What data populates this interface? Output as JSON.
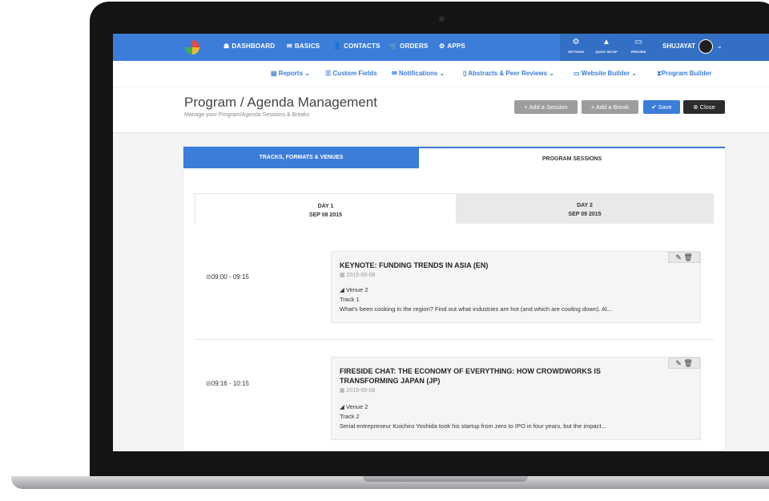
{
  "nav": {
    "items": [
      {
        "icon": "dashboard-icon",
        "glyph": "☗",
        "label": "DASHBOARD"
      },
      {
        "icon": "megaphone-icon",
        "glyph": "✉",
        "label": "BASICS"
      },
      {
        "icon": "user-icon",
        "glyph": "👤",
        "label": "CONTACTS"
      },
      {
        "icon": "cart-icon",
        "glyph": "🛒",
        "label": "ORDERS"
      },
      {
        "icon": "cogs-icon",
        "glyph": "⚙",
        "label": "APPS"
      }
    ],
    "tools": [
      {
        "icon": "settings-icon",
        "glyph": "⚙",
        "label": "SETTINGS"
      },
      {
        "icon": "rocket-icon",
        "glyph": "▲",
        "label": "QUICK SETUP"
      },
      {
        "icon": "monitor-icon",
        "glyph": "▭",
        "label": "PREVIEW"
      }
    ],
    "user_name": "SHUJAYAT"
  },
  "subnav": {
    "items": [
      {
        "label": "Reports",
        "glyph": "▤",
        "caret": true
      },
      {
        "label": "Custom Fields",
        "glyph": "☰",
        "caret": false
      },
      {
        "label": "Notifications",
        "glyph": "✉",
        "caret": true
      },
      {
        "label": "Abstracts & Peer Reviews",
        "glyph": "▯",
        "caret": true
      },
      {
        "label": "Website Builder",
        "glyph": "▭",
        "caret": true
      },
      {
        "label": "Program Builder",
        "glyph": "⧗",
        "caret": false
      }
    ]
  },
  "page": {
    "title": "Program / Agenda Management",
    "subtitle": "Manage your Program/Agenda Sessions & Breaks",
    "buttons": {
      "add_session": "+ Add a Session",
      "add_break": "+ Add a Break",
      "save": "✔ Save",
      "close": "⊗ Close"
    }
  },
  "tabs": {
    "tracks": "TRACKS, FORMATS & VENUES",
    "sessions": "PROGRAM SESSIONS"
  },
  "days": [
    {
      "name": "DAY 1",
      "date": "SEP 08 2015"
    },
    {
      "name": "DAY 2",
      "date": "SEP 09 2015"
    }
  ],
  "sessions": [
    {
      "time": "⊙09:00 - 09:15",
      "title": "KEYNOTE: FUNDING TRENDS IN ASIA (EN)",
      "date": "▦  2015-09-08",
      "venue": "◢ Venue 2",
      "track": "Track 1",
      "description": "What's been cooking in the region? Find out what industries are hot (and which are cooling down). Al..."
    },
    {
      "time": "⊙09:16 - 10:15",
      "title": "FIRESIDE CHAT: THE ECONOMY OF EVERYTHING: HOW CROWDWORKS IS TRANSFORMING JAPAN (JP)",
      "date": "▦  2015-09-08",
      "venue": "◢ Venue 2",
      "track": "Track 2",
      "description": "Serial entrepreneur Koichiro Yoshida took his startup from zero to IPO in four years, but the impact..."
    }
  ],
  "session_actions": "✎ 🗑"
}
